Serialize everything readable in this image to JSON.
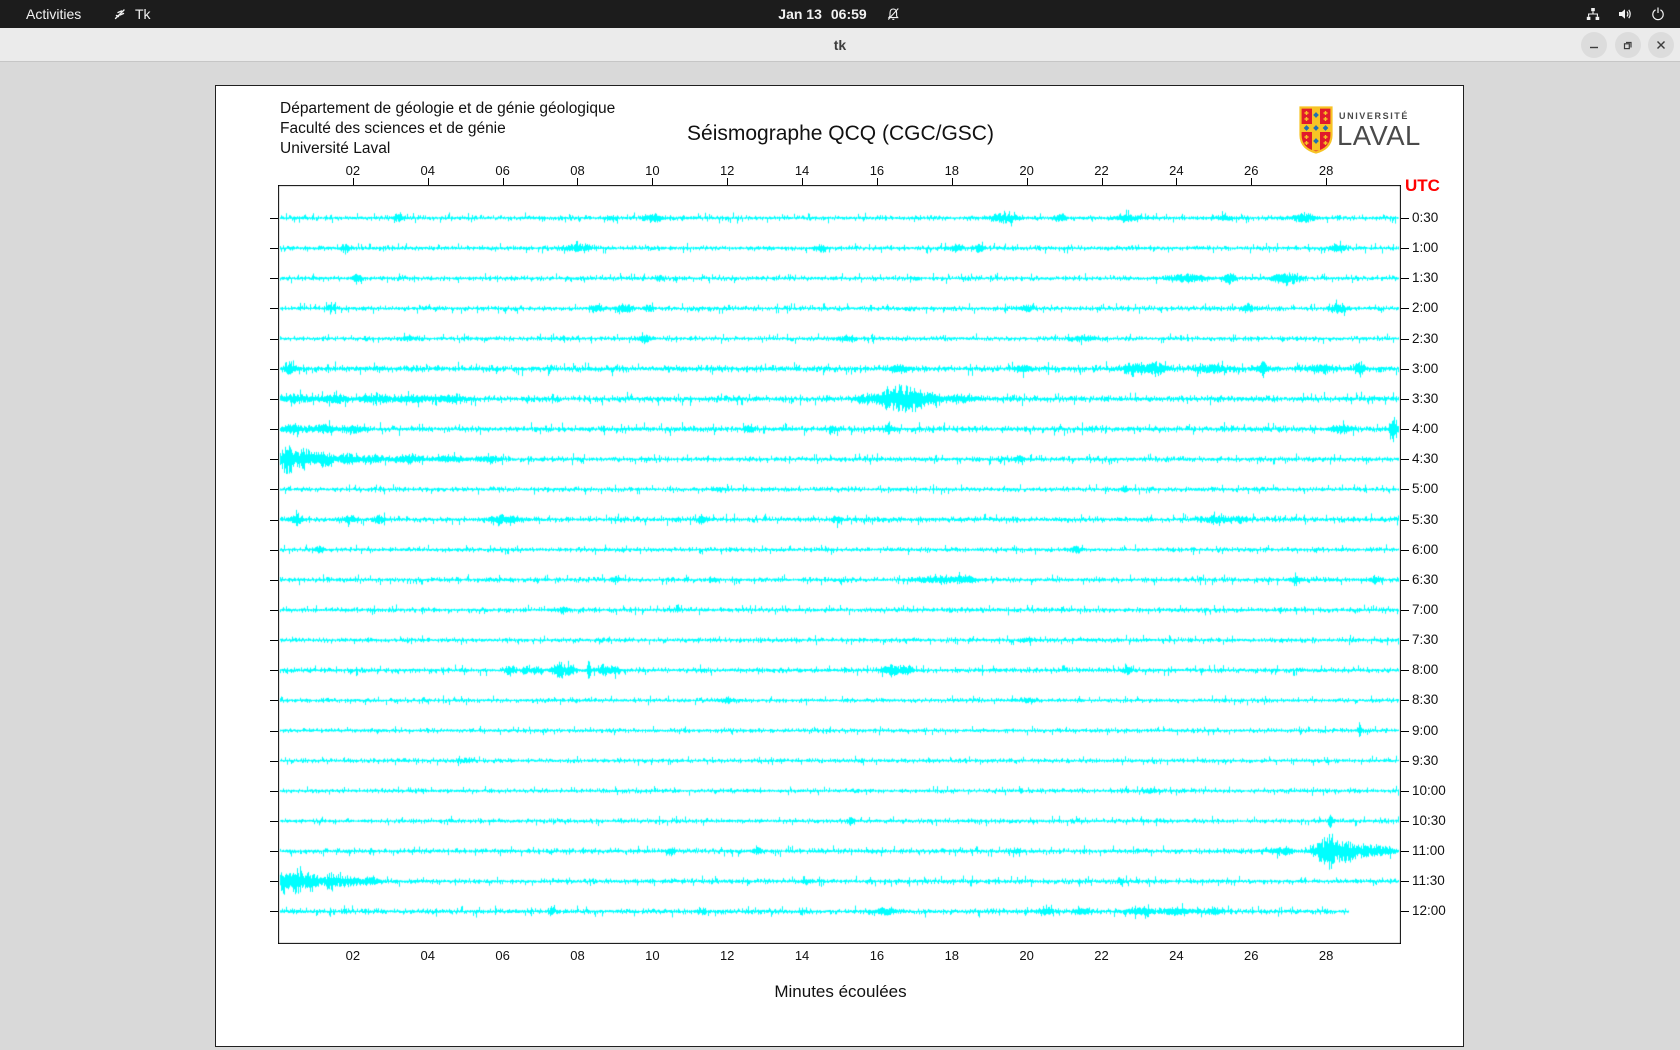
{
  "menubar": {
    "activities_label": "Activities",
    "app_label": "Tk",
    "clock_date": "Jan 13",
    "clock_time": "06:59",
    "icons": [
      "tk-icon",
      "bell-slash-icon",
      "network-icon",
      "volume-icon",
      "power-icon"
    ]
  },
  "titlebar": {
    "title": "tk",
    "buttons": [
      "minimize",
      "maximize",
      "close"
    ]
  },
  "seismograph": {
    "address_lines": [
      "Département de géologie et de génie géologique",
      "Faculté des sciences et de génie",
      "Université Laval"
    ],
    "title": "Séismographe QCQ (CGC/GSC)",
    "logo": {
      "small_text": "UNIVERSITÉ",
      "large_text": "LAVAL"
    },
    "utc_label": "UTC",
    "xlabel": "Minutes écoulées"
  },
  "colors": {
    "trace": "#00ffff",
    "utc_label": "#ff0000",
    "menubar_bg": "#1c1c1c",
    "window_bg": "#d9d9d9",
    "logo_red": "#e11a2b",
    "logo_gold": "#f7c325",
    "logo_blue": "#1f6fb4"
  },
  "chart_data": {
    "type": "line",
    "xlabel": "Minutes écoulées",
    "y_axis_right_title": "UTC",
    "x_range_minutes": [
      0,
      30
    ],
    "x_ticks": [
      [
        2,
        "02"
      ],
      [
        4,
        "04"
      ],
      [
        6,
        "06"
      ],
      [
        8,
        "08"
      ],
      [
        10,
        "10"
      ],
      [
        12,
        "12"
      ],
      [
        14,
        "14"
      ],
      [
        16,
        "16"
      ],
      [
        18,
        "18"
      ],
      [
        20,
        "20"
      ],
      [
        22,
        "22"
      ],
      [
        24,
        "24"
      ],
      [
        26,
        "26"
      ],
      [
        28,
        "28"
      ]
    ],
    "rows": [
      {
        "utc": "0:30",
        "noise": 1.0,
        "end": 30,
        "events": [
          [
            3.2,
            3,
            0.12
          ],
          [
            8.9,
            2.5,
            0.1
          ],
          [
            10.0,
            2.5,
            0.25
          ],
          [
            19.4,
            4.5,
            0.35
          ],
          [
            20.9,
            3,
            0.15
          ],
          [
            22.7,
            3.5,
            0.25
          ],
          [
            25.3,
            2.5,
            0.15
          ],
          [
            27.4,
            3.5,
            0.3
          ]
        ]
      },
      {
        "utc": "1:00",
        "noise": 1.0,
        "end": 30,
        "events": [
          [
            1.8,
            3.5,
            0.12
          ],
          [
            8.0,
            3.5,
            0.3
          ],
          [
            14.5,
            3,
            0.12
          ],
          [
            18.1,
            3.5,
            0.15
          ],
          [
            18.7,
            3,
            0.12
          ],
          [
            28.3,
            3,
            0.2
          ]
        ]
      },
      {
        "utc": "1:30",
        "noise": 1.0,
        "end": 30,
        "events": [
          [
            2.1,
            4.5,
            0.12
          ],
          [
            10.2,
            2.5,
            0.1
          ],
          [
            24.3,
            3,
            0.5
          ],
          [
            25.4,
            5,
            0.15
          ],
          [
            26.8,
            3.5,
            0.3
          ],
          [
            27.1,
            3,
            0.2
          ]
        ]
      },
      {
        "utc": "2:00",
        "noise": 1.0,
        "end": 30,
        "events": [
          [
            1.4,
            3.5,
            0.12
          ],
          [
            8.5,
            3,
            0.15
          ],
          [
            9.2,
            3.5,
            0.2
          ],
          [
            9.9,
            3,
            0.12
          ],
          [
            20.0,
            3,
            0.15
          ],
          [
            25.9,
            4.5,
            0.15
          ],
          [
            28.3,
            4.5,
            0.2
          ]
        ]
      },
      {
        "utc": "2:30",
        "noise": 0.95,
        "end": 30,
        "events": [
          [
            3.5,
            2,
            0.2
          ],
          [
            9.8,
            3.5,
            0.15
          ],
          [
            15.2,
            2,
            0.2
          ],
          [
            21.5,
            2,
            0.3
          ]
        ]
      },
      {
        "utc": "3:00",
        "noise": 1.35,
        "end": 30,
        "events": [
          [
            0.3,
            4.5,
            0.15
          ],
          [
            16.6,
            3.5,
            0.2
          ],
          [
            19.9,
            3,
            0.2
          ],
          [
            22.9,
            4.5,
            0.4
          ],
          [
            23.5,
            4.5,
            0.25
          ],
          [
            24.9,
            3.5,
            0.4
          ],
          [
            26.3,
            6,
            0.12
          ],
          [
            27.9,
            3.5,
            0.3
          ],
          [
            28.9,
            7,
            0.1
          ]
        ]
      },
      {
        "utc": "3:30",
        "noise": 1.3,
        "end": 30,
        "events": [
          [
            0.5,
            3.5,
            0.4
          ],
          [
            1.5,
            3.5,
            0.35
          ],
          [
            2.6,
            3.5,
            0.4
          ],
          [
            3.6,
            3,
            0.35
          ],
          [
            4.6,
            2.5,
            0.4
          ],
          [
            15.7,
            4,
            0.25
          ],
          [
            16.2,
            7,
            0.2
          ],
          [
            16.6,
            14,
            0.25
          ],
          [
            17.0,
            9,
            0.2
          ],
          [
            17.4,
            5,
            0.25
          ],
          [
            18.2,
            3,
            0.4
          ]
        ]
      },
      {
        "utc": "4:00",
        "noise": 1.25,
        "end": 30,
        "events": [
          [
            0.4,
            3.5,
            0.25
          ],
          [
            1.2,
            3.5,
            0.3
          ],
          [
            2.0,
            3,
            0.25
          ],
          [
            12.6,
            3,
            0.12
          ],
          [
            14.8,
            2.5,
            0.12
          ],
          [
            16.3,
            5,
            0.08
          ],
          [
            28.4,
            3.5,
            0.25
          ],
          [
            29.8,
            11,
            0.1
          ]
        ]
      },
      {
        "utc": "4:30",
        "noise": 1.1,
        "end": 30,
        "events": [
          [
            0.25,
            15,
            0.18
          ],
          [
            0.7,
            11,
            0.2
          ],
          [
            1.2,
            7,
            0.25
          ],
          [
            1.8,
            5,
            0.25
          ],
          [
            2.5,
            3.5,
            0.35
          ],
          [
            3.5,
            2.8,
            0.4
          ],
          [
            4.6,
            2.6,
            0.35
          ],
          [
            5.6,
            2.4,
            0.3
          ],
          [
            19.8,
            3.5,
            0.1
          ]
        ]
      },
      {
        "utc": "5:00",
        "noise": 0.95,
        "end": 30,
        "events": [
          [
            11.8,
            1.8,
            0.15
          ],
          [
            22.6,
            2.8,
            0.08
          ]
        ]
      },
      {
        "utc": "5:30",
        "noise": 1.15,
        "end": 30,
        "events": [
          [
            0.5,
            4.5,
            0.15
          ],
          [
            1.9,
            3.5,
            0.15
          ],
          [
            2.7,
            3.5,
            0.15
          ],
          [
            6.0,
            3.5,
            0.35
          ],
          [
            11.3,
            2.5,
            0.12
          ],
          [
            14.9,
            2.5,
            0.12
          ],
          [
            25.0,
            3,
            0.3
          ],
          [
            25.7,
            2.8,
            0.2
          ]
        ]
      },
      {
        "utc": "6:00",
        "noise": 0.95,
        "end": 30,
        "events": [
          [
            1.1,
            3.5,
            0.12
          ],
          [
            21.3,
            2.8,
            0.15
          ]
        ]
      },
      {
        "utc": "6:30",
        "noise": 1.0,
        "end": 30,
        "events": [
          [
            9.0,
            2.8,
            0.1
          ],
          [
            11.6,
            2.5,
            0.1
          ],
          [
            17.5,
            2.8,
            0.5
          ],
          [
            18.3,
            2.8,
            0.3
          ],
          [
            27.2,
            2,
            0.2
          ],
          [
            29.3,
            3.5,
            0.12
          ]
        ]
      },
      {
        "utc": "7:00",
        "noise": 1.0,
        "end": 30,
        "events": [
          [
            7.6,
            2.8,
            0.15
          ]
        ]
      },
      {
        "utc": "7:30",
        "noise": 0.95,
        "end": 30,
        "events": [
          [
            20.0,
            1.8,
            0.2
          ]
        ]
      },
      {
        "utc": "8:00",
        "noise": 1.05,
        "end": 30,
        "events": [
          [
            6.2,
            4.5,
            0.12
          ],
          [
            6.6,
            3.5,
            0.1
          ],
          [
            6.9,
            3.5,
            0.1
          ],
          [
            7.5,
            7,
            0.18
          ],
          [
            7.8,
            4.5,
            0.12
          ],
          [
            8.3,
            14,
            0.04
          ],
          [
            8.7,
            5,
            0.15
          ],
          [
            9.0,
            3.5,
            0.12
          ],
          [
            16.4,
            4.5,
            0.25
          ],
          [
            16.8,
            3.5,
            0.15
          ],
          [
            22.7,
            3.5,
            0.1
          ]
        ]
      },
      {
        "utc": "8:30",
        "noise": 0.9,
        "end": 30,
        "events": [
          [
            12.0,
            1.8,
            0.2
          ],
          [
            20.0,
            1.8,
            0.2
          ]
        ]
      },
      {
        "utc": "9:00",
        "noise": 0.9,
        "end": 30,
        "events": [
          [
            28.9,
            7,
            0.06
          ]
        ]
      },
      {
        "utc": "9:30",
        "noise": 0.9,
        "end": 30,
        "events": [
          [
            5.0,
            1.5,
            0.2
          ]
        ]
      },
      {
        "utc": "10:00",
        "noise": 0.9,
        "end": 30,
        "events": [
          [
            23.3,
            2.2,
            0.15
          ]
        ]
      },
      {
        "utc": "10:30",
        "noise": 0.95,
        "end": 30,
        "events": [
          [
            15.3,
            3.5,
            0.08
          ],
          [
            28.1,
            6,
            0.06
          ]
        ]
      },
      {
        "utc": "11:00",
        "noise": 1.05,
        "end": 30,
        "events": [
          [
            10.5,
            2.8,
            0.1
          ],
          [
            12.8,
            2.8,
            0.1
          ],
          [
            19.7,
            2.2,
            0.12
          ],
          [
            26.8,
            2.8,
            0.3
          ],
          [
            27.8,
            7,
            0.18
          ],
          [
            28.1,
            16,
            0.2
          ],
          [
            28.5,
            9,
            0.25
          ],
          [
            29.0,
            5,
            0.3
          ],
          [
            29.5,
            4,
            0.3
          ]
        ]
      },
      {
        "utc": "11:30",
        "noise": 1.05,
        "end": 30,
        "events": [
          [
            0.15,
            11,
            0.12
          ],
          [
            0.5,
            13,
            0.18
          ],
          [
            0.9,
            9,
            0.2
          ],
          [
            1.4,
            7,
            0.18
          ],
          [
            1.8,
            4.5,
            0.25
          ],
          [
            2.4,
            3,
            0.3
          ],
          [
            14.1,
            2.8,
            0.1
          ],
          [
            22.5,
            2.8,
            0.08
          ]
        ]
      },
      {
        "utc": "12:00",
        "noise": 1.1,
        "end": 28.6,
        "events": [
          [
            7.3,
            5.5,
            0.06
          ],
          [
            11.3,
            2.5,
            0.1
          ],
          [
            16.2,
            2.8,
            0.3
          ],
          [
            20.5,
            2.8,
            0.25
          ],
          [
            21.5,
            2.5,
            0.2
          ],
          [
            23.0,
            2.8,
            0.4
          ],
          [
            24.0,
            2.8,
            0.4
          ],
          [
            25.0,
            2.5,
            0.25
          ]
        ]
      }
    ]
  }
}
